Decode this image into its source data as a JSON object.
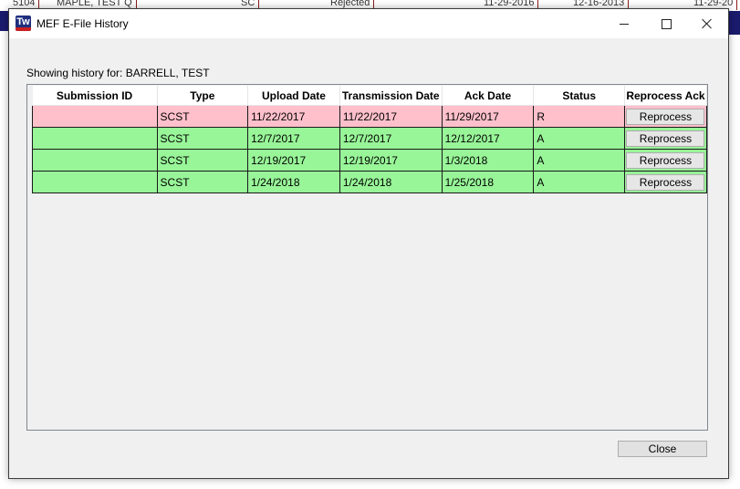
{
  "background_app": {
    "row": [
      "5104",
      "MAPLE, TEST Q",
      "SC",
      "Rejected",
      "11-29-2016",
      "12-16-2013",
      "11-29-20"
    ]
  },
  "window": {
    "title": "MEF E-File History",
    "icon_text": "Tw",
    "icon_subtext": "1040"
  },
  "history_label": "Showing history for: BARRELL, TEST",
  "grid": {
    "columns": [
      "Submission ID",
      "Type",
      "Upload Date",
      "Transmission Date",
      "Ack Date",
      "Status",
      "Reprocess Ack"
    ],
    "rows": [
      {
        "submission_id": "",
        "type": "SCST",
        "upload_date": "11/22/2017",
        "transmission_date": "11/22/2017",
        "ack_date": "11/29/2017",
        "status": "R",
        "action": "Reprocess",
        "color": "#ffc0cb"
      },
      {
        "submission_id": "",
        "type": "SCST",
        "upload_date": "12/7/2017",
        "transmission_date": "12/7/2017",
        "ack_date": "12/12/2017",
        "status": "A",
        "action": "Reprocess",
        "color": "#98f598"
      },
      {
        "submission_id": "",
        "type": "SCST",
        "upload_date": "12/19/2017",
        "transmission_date": "12/19/2017",
        "ack_date": "1/3/2018",
        "status": "A",
        "action": "Reprocess",
        "color": "#98f598"
      },
      {
        "submission_id": "",
        "type": "SCST",
        "upload_date": "1/24/2018",
        "transmission_date": "1/24/2018",
        "ack_date": "1/25/2018",
        "status": "A",
        "action": "Reprocess",
        "color": "#98f598"
      }
    ]
  },
  "close_label": "Close",
  "colors": {
    "rejected_row": "#ffc0cb",
    "accepted_row": "#98f598",
    "app_icon_blue": "#1f2f7f"
  }
}
